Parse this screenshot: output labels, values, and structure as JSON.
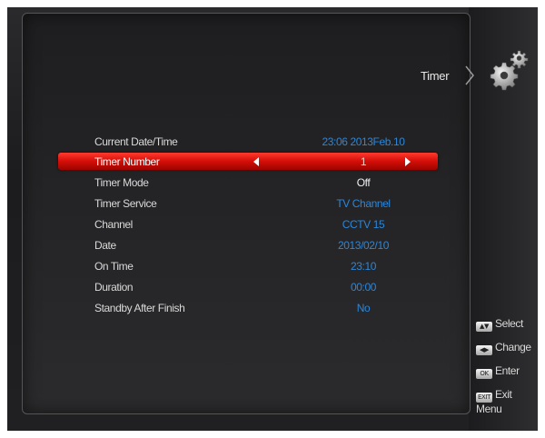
{
  "header": {
    "title": "Timer",
    "icon": "gears-icon"
  },
  "rows": [
    {
      "label": "Current Date/Time",
      "value": "23:06 2013Feb.10"
    },
    {
      "label": "Timer Number",
      "value": "1"
    },
    {
      "label": "Timer Mode",
      "value": "Off"
    },
    {
      "label": "Timer Service",
      "value": "TV Channel"
    },
    {
      "label": "Channel",
      "value": "CCTV 15"
    },
    {
      "label": "Date",
      "value": "2013/02/10"
    },
    {
      "label": "On Time",
      "value": "23:10"
    },
    {
      "label": "Duration",
      "value": "00:00"
    },
    {
      "label": "Standby After Finish",
      "value": "No"
    }
  ],
  "help": [
    {
      "key": "▲▼",
      "label": "Select"
    },
    {
      "key": "◀▶",
      "label": "Change"
    },
    {
      "key": "OK",
      "label": "Enter"
    },
    {
      "key": "EXIT",
      "label": "Exit Menu"
    }
  ],
  "colors": {
    "accent": "#2c86d8",
    "highlight": "#d40e08"
  }
}
